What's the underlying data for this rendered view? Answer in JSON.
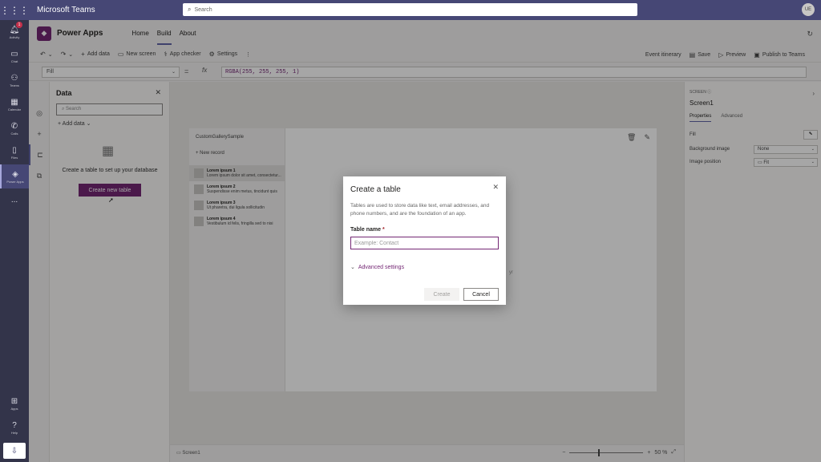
{
  "teams": {
    "title": "Microsoft Teams",
    "search_placeholder": "Search",
    "avatar_initials": "UE",
    "rail": [
      {
        "label": "Activity",
        "badge": "1"
      },
      {
        "label": "Chat"
      },
      {
        "label": "Teams"
      },
      {
        "label": "Calendar"
      },
      {
        "label": "Calls"
      },
      {
        "label": "Files"
      },
      {
        "label": "Power Apps"
      }
    ],
    "rail_more": "...",
    "rail_bottom": [
      {
        "label": "Apps"
      },
      {
        "label": "Help"
      }
    ]
  },
  "app": {
    "name": "Power Apps",
    "tabs": [
      "Home",
      "Build",
      "About"
    ],
    "selected_tab": "Build"
  },
  "command_bar": {
    "add_data": "Add data",
    "new_screen": "New screen",
    "app_checker": "App checker",
    "settings": "Settings",
    "event_itinerary": "Event itinerary",
    "save": "Save",
    "preview": "Preview",
    "publish": "Publish to Teams"
  },
  "formula_bar": {
    "property": "Fill",
    "equals": "=",
    "fx": "fx",
    "formula": "RGBA(255, 255, 255, 1)"
  },
  "data_pane": {
    "title": "Data",
    "search_placeholder": "Search",
    "add_data": "Add data",
    "empty_message": "Create a table to set up your database",
    "create_button": "Create new table"
  },
  "canvas": {
    "gallery_title": "CustomGallerySample",
    "new_record": "New record",
    "items": [
      {
        "title": "Lorem ipsum 1",
        "subtitle": "Lorem ipsum dolor sit amet, consectetur..."
      },
      {
        "title": "Lorem ipsum 2",
        "subtitle": "Suspendisse enim metus, tincidunt quis"
      },
      {
        "title": "Lorem ipsum 3",
        "subtitle": "Ut pharetra, dui ligula sollicitudin"
      },
      {
        "title": "Lorem ipsum 4",
        "subtitle": "Vestibulum id felis, fringilla sed to nisi"
      }
    ],
    "ghost_text": "yr"
  },
  "status_bar": {
    "screen": "Screen1",
    "zoom_minus": "−",
    "zoom_plus": "+",
    "zoom": "50 %"
  },
  "properties_pane": {
    "type_label": "SCREEN",
    "name": "Screen1",
    "tabs": [
      "Properties",
      "Advanced"
    ],
    "fill_label": "Fill",
    "background_image_label": "Background image",
    "background_image_value": "None",
    "image_position_label": "Image position",
    "image_position_value": "Fit"
  },
  "dialog": {
    "title": "Create a table",
    "description": "Tables are used to store data like text, email addresses, and phone numbers, and are the foundation of an app.",
    "name_label": "Table name",
    "required_mark": "*",
    "name_placeholder": "Example: Contact",
    "advanced_settings": "Advanced settings",
    "create_button": "Create",
    "cancel_button": "Cancel"
  }
}
